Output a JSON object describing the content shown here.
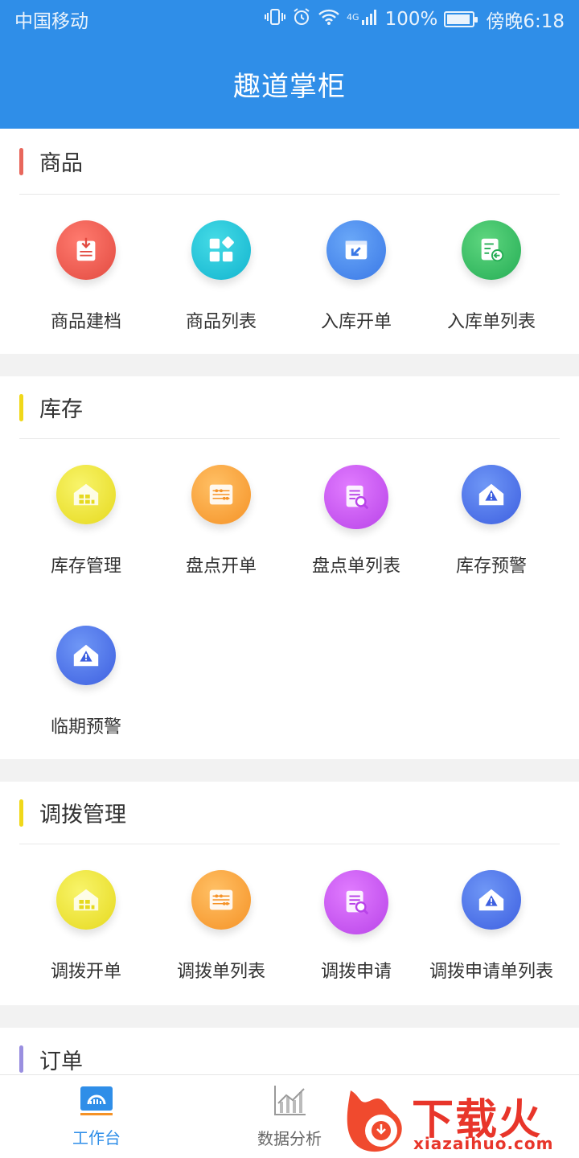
{
  "status": {
    "carrier": "中国移动",
    "network": "4G",
    "battery": "100%",
    "time": "傍晚6:18"
  },
  "appbar": {
    "title": "趣道掌柜"
  },
  "sections": [
    {
      "title": "商品",
      "color": "#e8675c",
      "items": [
        {
          "label": "商品建档",
          "icon": "product-archive-icon"
        },
        {
          "label": "商品列表",
          "icon": "product-list-icon"
        },
        {
          "label": "入库开单",
          "icon": "inbound-order-icon"
        },
        {
          "label": "入库单列表",
          "icon": "inbound-list-icon"
        }
      ]
    },
    {
      "title": "库存",
      "color": "#f0d81a",
      "items": [
        {
          "label": "库存管理",
          "icon": "warehouse-icon"
        },
        {
          "label": "盘点开单",
          "icon": "abacus-icon"
        },
        {
          "label": "盘点单列表",
          "icon": "document-search-icon"
        },
        {
          "label": "库存预警",
          "icon": "warning-house-icon"
        },
        {
          "label": "临期预警",
          "icon": "warning-house-icon"
        }
      ]
    },
    {
      "title": "调拨管理",
      "color": "#f0d81a",
      "items": [
        {
          "label": "调拨开单",
          "icon": "warehouse-icon"
        },
        {
          "label": "调拨单列表",
          "icon": "abacus-icon"
        },
        {
          "label": "调拨申请",
          "icon": "document-search-icon"
        },
        {
          "label": "调拨申请单列表",
          "icon": "warning-house-icon"
        }
      ]
    },
    {
      "title": "订单",
      "color": "#9a8fe0"
    }
  ],
  "tabbar": [
    {
      "label": "工作台",
      "active": true,
      "icon": "workbench-icon"
    },
    {
      "label": "数据分析",
      "active": false,
      "icon": "chart-icon"
    }
  ],
  "watermark": {
    "text": "下载火",
    "sub": "xiazaihuo.com"
  }
}
